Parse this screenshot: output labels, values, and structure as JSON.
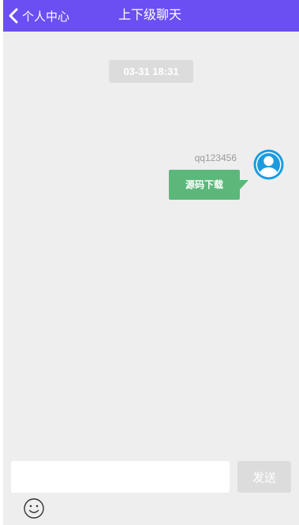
{
  "header": {
    "back_label": "个人中心",
    "title": "上下级聊天",
    "background_color": "#6b4ff2",
    "back_icon": "chevron-left-icon"
  },
  "chat": {
    "background_color": "#eeeeee",
    "timestamp": "03-31 18:31",
    "messages": [
      {
        "sender": "qq123456",
        "text": "源码下载",
        "side": "right",
        "bubble_color": "#5cb87a",
        "avatar_icon": "user-avatar-icon",
        "avatar_color": "#1a9be0"
      }
    ]
  },
  "composer": {
    "input_value": "",
    "send_label": "发送",
    "emoji_icon": "smiley-icon"
  }
}
